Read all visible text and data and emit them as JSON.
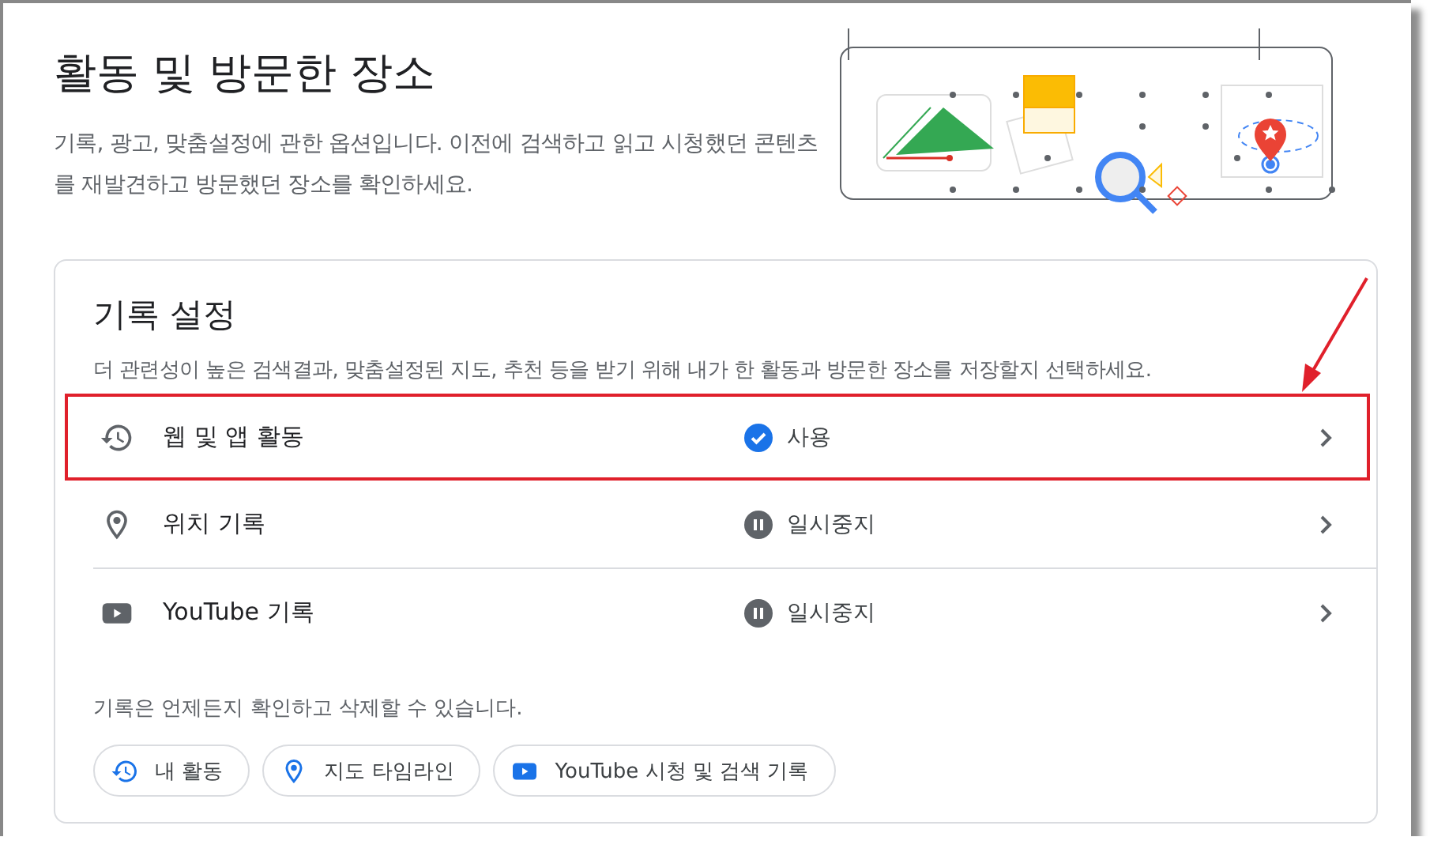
{
  "page": {
    "title": "활동 및 방문한 장소",
    "description": "기록, 광고, 맞춤설정에 관한 옵션입니다. 이전에 검색하고 읽고 시청했던 콘텐츠를 재발견하고 방문했던 장소를 확인하세요."
  },
  "history_settings": {
    "title": "기록 설정",
    "description": "더 관련성이 높은 검색결과, 맞춤설정된 지도, 추천 등을 받기 위해 내가 한 활동과 방문한 장소를 저장할지 선택하세요.",
    "rows": [
      {
        "kind": "history",
        "label": "웹 및 앱 활동",
        "status": "사용",
        "enabled": true,
        "highlighted": true
      },
      {
        "kind": "location",
        "label": "위치 기록",
        "status": "일시중지",
        "enabled": false,
        "highlighted": false
      },
      {
        "kind": "youtube",
        "label": "YouTube 기록",
        "status": "일시중지",
        "enabled": false,
        "highlighted": false
      }
    ],
    "footer_note": "기록은 언제든지 확인하고 삭제할 수 있습니다.",
    "links": [
      {
        "kind": "history",
        "label": "내 활동"
      },
      {
        "kind": "location",
        "label": "지도 타임라인"
      },
      {
        "kind": "youtube",
        "label": "YouTube 시청 및 검색 기록"
      }
    ]
  }
}
